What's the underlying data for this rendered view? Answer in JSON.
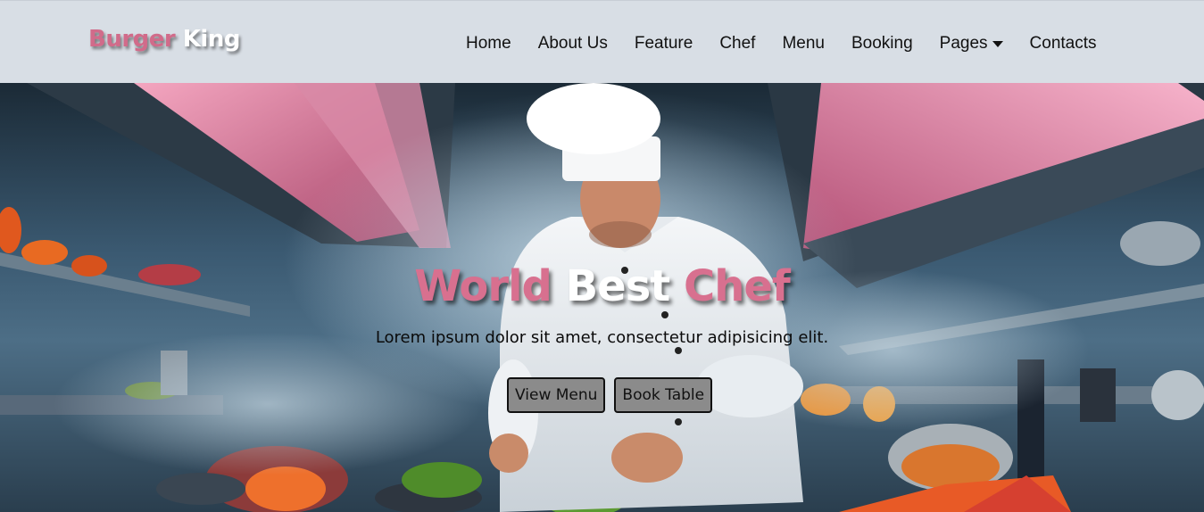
{
  "brand": {
    "part1": "Burger ",
    "part2": "King"
  },
  "nav": [
    {
      "label": "Home"
    },
    {
      "label": "About Us"
    },
    {
      "label": "Feature"
    },
    {
      "label": "Chef"
    },
    {
      "label": "Menu"
    },
    {
      "label": "Booking"
    },
    {
      "label": "Pages",
      "icon": "caret-down-icon"
    },
    {
      "label": "Contacts"
    }
  ],
  "hero": {
    "title_part1": "World ",
    "title_part2": "Best ",
    "title_part3": "Chef",
    "subtitle": "Lorem ipsum dolor sit amet, consectetur adipisicing elit.",
    "view_menu_label": "View Menu",
    "book_table_label": "Book Table"
  },
  "colors": {
    "accent_pink": "#d8708f",
    "navbar_bg": "#d8dee5",
    "button_bg": "#8b8b8b"
  }
}
